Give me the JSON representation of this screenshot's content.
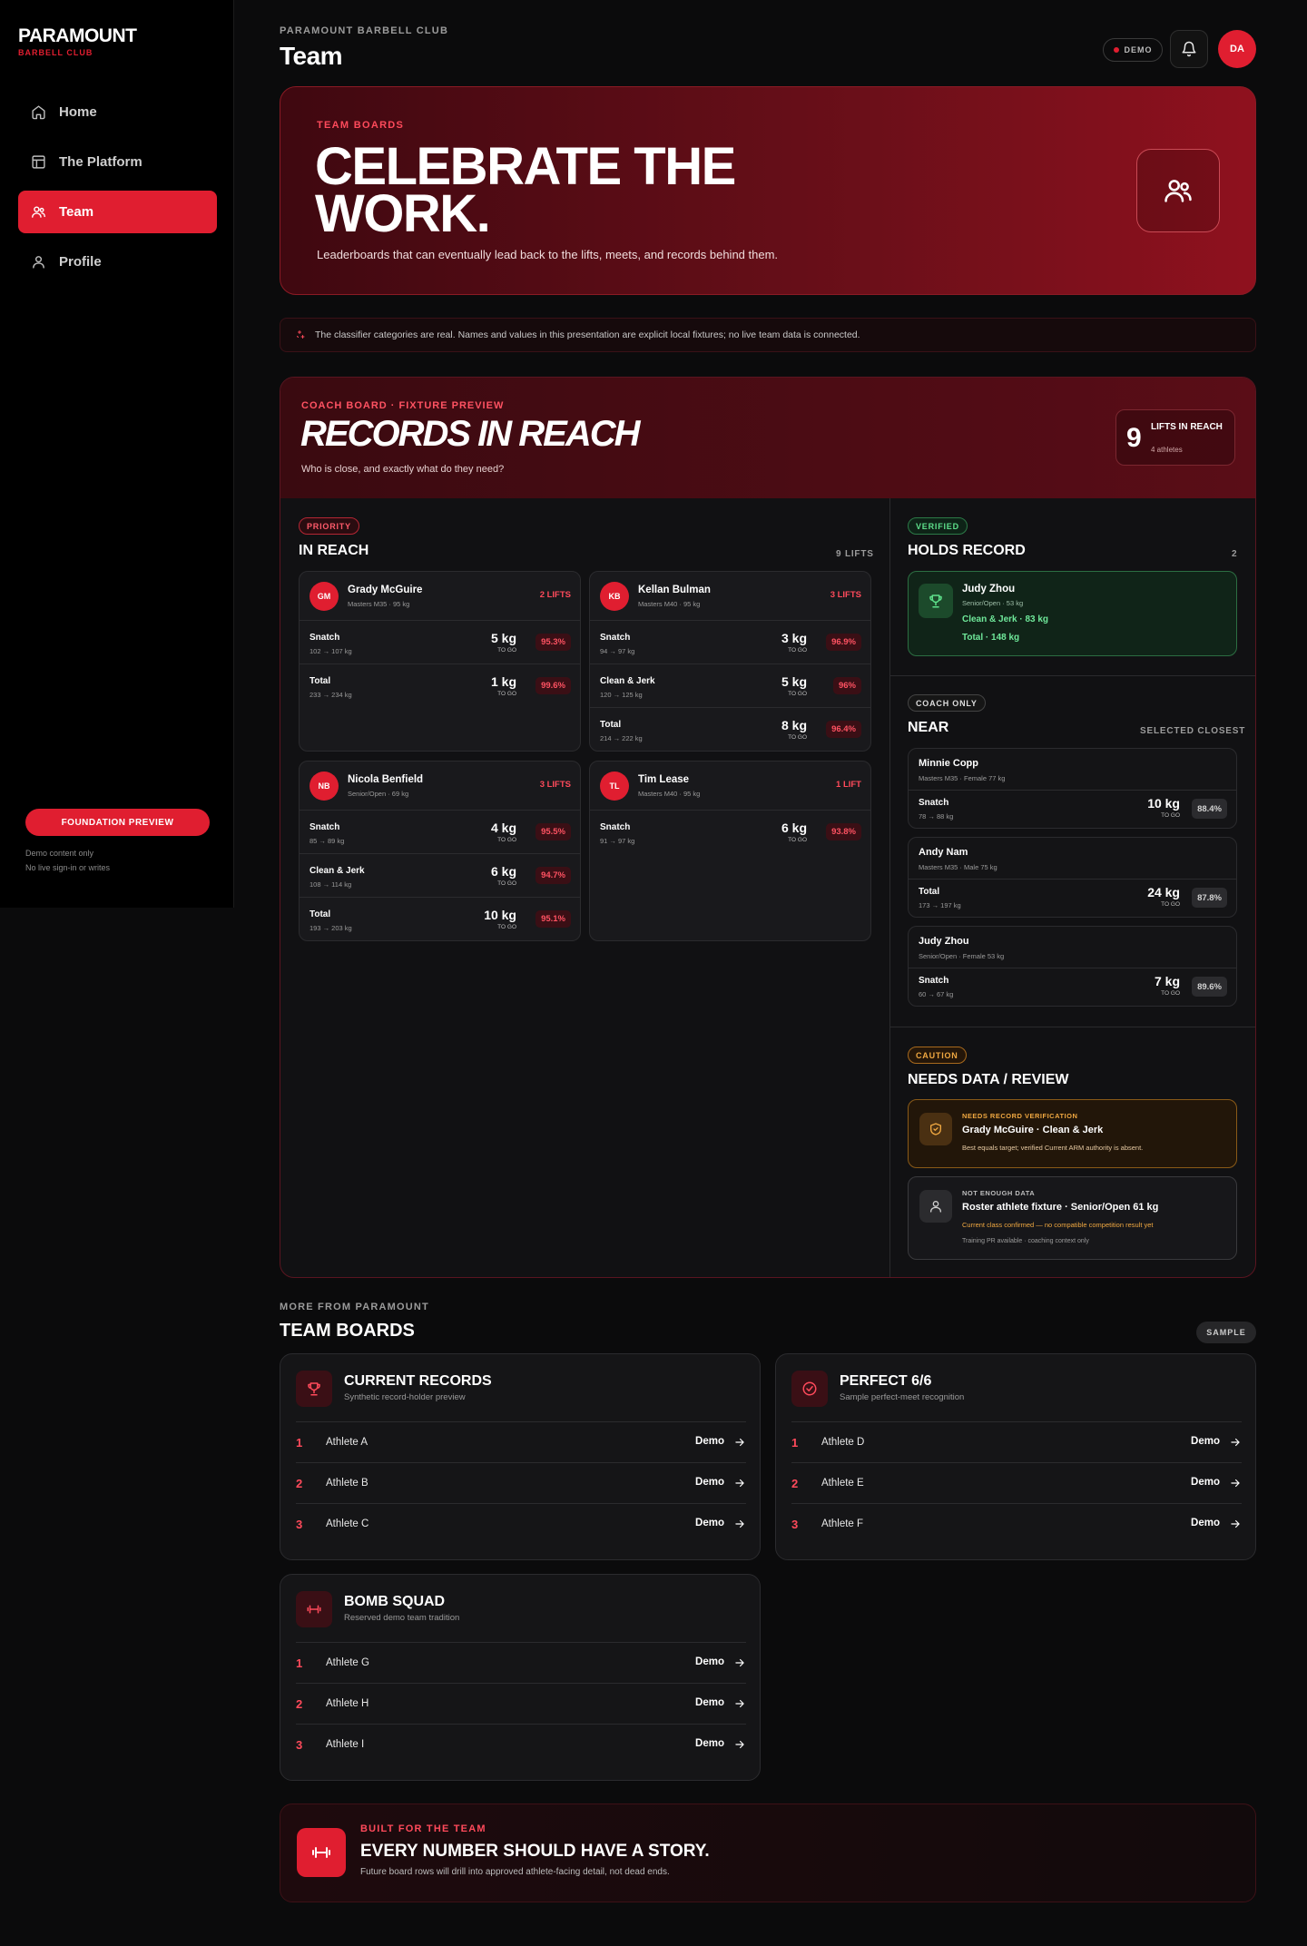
{
  "sidebar": {
    "brand_name": "PARAMOUNT",
    "brand_sub": "BARBELL CLUB",
    "items": [
      {
        "label": "Home",
        "icon": "home-icon"
      },
      {
        "label": "The Platform",
        "icon": "layout-icon"
      },
      {
        "label": "Team",
        "icon": "users-icon",
        "active": true
      },
      {
        "label": "Profile",
        "icon": "user-icon"
      }
    ],
    "preview_button": "FOUNDATION PREVIEW",
    "note_1": "Demo content only",
    "note_2": "No live sign-in or writes"
  },
  "header": {
    "kicker": "PARAMOUNT BARBELL CLUB",
    "title": "Team",
    "demo_label": "DEMO",
    "avatar_initials": "DA"
  },
  "hero": {
    "kicker": "TEAM BOARDS",
    "headline": "CELEBRATE THE WORK.",
    "description": "Leaderboards that can eventually lead back to the lifts, meets, and records behind them."
  },
  "notice": "The classifier categories are real. Names and values in this presentation are explicit local fixtures; no live team data is connected.",
  "board": {
    "kicker": "COACH BOARD · FIXTURE PREVIEW",
    "title": "RECORDS IN REACH",
    "subtitle": "Who is close, and exactly what do they need?",
    "lifts_count": "9",
    "lifts_label": "LIFTS IN REACH",
    "lifts_sub": "4 athletes",
    "in_reach": {
      "badge": "PRIORITY",
      "title": "IN REACH",
      "count": "9 LIFTS",
      "athletes": [
        {
          "initials": "GM",
          "name": "Grady McGuire",
          "meta": "Masters M35 · 95 kg",
          "count": "2 LIFTS",
          "lifts": [
            {
              "name": "Snatch",
              "range": "102 → 107 kg",
              "kg": "5 kg",
              "togo": "TO GO",
              "pct": "95.3%"
            },
            {
              "name": "Total",
              "range": "233 → 234 kg",
              "kg": "1 kg",
              "togo": "TO GO",
              "pct": "99.6%"
            }
          ]
        },
        {
          "initials": "KB",
          "name": "Kellan Bulman",
          "meta": "Masters M40 · 95 kg",
          "count": "3 LIFTS",
          "lifts": [
            {
              "name": "Snatch",
              "range": "94 → 97 kg",
              "kg": "3 kg",
              "togo": "TO GO",
              "pct": "96.9%"
            },
            {
              "name": "Clean & Jerk",
              "range": "120 → 125 kg",
              "kg": "5 kg",
              "togo": "TO GO",
              "pct": "96%"
            },
            {
              "name": "Total",
              "range": "214 → 222 kg",
              "kg": "8 kg",
              "togo": "TO GO",
              "pct": "96.4%"
            }
          ]
        },
        {
          "initials": "NB",
          "name": "Nicola Benfield",
          "meta": "Senior/Open · 69 kg",
          "count": "3 LIFTS",
          "lifts": [
            {
              "name": "Snatch",
              "range": "85 → 89 kg",
              "kg": "4 kg",
              "togo": "TO GO",
              "pct": "95.5%"
            },
            {
              "name": "Clean & Jerk",
              "range": "108 → 114 kg",
              "kg": "6 kg",
              "togo": "TO GO",
              "pct": "94.7%"
            },
            {
              "name": "Total",
              "range": "193 → 203 kg",
              "kg": "10 kg",
              "togo": "TO GO",
              "pct": "95.1%"
            }
          ]
        },
        {
          "initials": "TL",
          "name": "Tim Lease",
          "meta": "Masters M40 · 95 kg",
          "count": "1 LIFT",
          "lifts": [
            {
              "name": "Snatch",
              "range": "91 → 97 kg",
              "kg": "6 kg",
              "togo": "TO GO",
              "pct": "93.8%"
            }
          ]
        }
      ]
    },
    "holds": {
      "badge": "VERIFIED",
      "title": "HOLDS RECORD",
      "count": "2",
      "name": "Judy Zhou",
      "meta": "Senior/Open · 53 kg",
      "line1": "Clean & Jerk · 83 kg",
      "line2": "Total · 148 kg"
    },
    "near": {
      "badge": "COACH ONLY",
      "title": "NEAR",
      "right": "SELECTED CLOSEST",
      "items": [
        {
          "name": "Minnie Copp",
          "meta": "Masters M35 · Female 77 kg",
          "lift": "Snatch",
          "range": "78 → 88 kg",
          "kg": "10 kg",
          "togo": "TO GO",
          "pct": "88.4%"
        },
        {
          "name": "Andy Nam",
          "meta": "Masters M35 · Male 75 kg",
          "lift": "Total",
          "range": "173 → 197 kg",
          "kg": "24 kg",
          "togo": "TO GO",
          "pct": "87.8%"
        },
        {
          "name": "Judy Zhou",
          "meta": "Senior/Open · Female 53 kg",
          "lift": "Snatch",
          "range": "60 → 67 kg",
          "kg": "7 kg",
          "togo": "TO GO",
          "pct": "89.6%"
        }
      ]
    },
    "review": {
      "badge": "CAUTION",
      "title": "NEEDS DATA / REVIEW",
      "items": [
        {
          "kicker": "NEEDS RECORD VERIFICATION",
          "title": "Grady McGuire · Clean & Jerk",
          "desc": "Best equals target; verified Current ARM authority is absent."
        },
        {
          "kicker": "NOT ENOUGH DATA",
          "title": "Roster athlete fixture · Senior/Open 61 kg",
          "desc": "Current class confirmed — no compatible competition result yet",
          "desc2": "Training PR available · coaching context only"
        }
      ]
    }
  },
  "more": {
    "kicker": "MORE FROM PARAMOUNT",
    "title": "TEAM BOARDS",
    "sample": "SAMPLE",
    "boards": [
      {
        "title": "CURRENT RECORDS",
        "sub": "Synthetic record-holder preview",
        "icon": "trophy-icon",
        "rows": [
          {
            "rank": "1",
            "name": "Athlete A",
            "val": "Demo"
          },
          {
            "rank": "2",
            "name": "Athlete B",
            "val": "Demo"
          },
          {
            "rank": "3",
            "name": "Athlete C",
            "val": "Demo"
          }
        ]
      },
      {
        "title": "PERFECT 6/6",
        "sub": "Sample perfect-meet recognition",
        "icon": "check-circle-icon",
        "rows": [
          {
            "rank": "1",
            "name": "Athlete D",
            "val": "Demo"
          },
          {
            "rank": "2",
            "name": "Athlete E",
            "val": "Demo"
          },
          {
            "rank": "3",
            "name": "Athlete F",
            "val": "Demo"
          }
        ]
      },
      {
        "title": "BOMB SQUAD",
        "sub": "Reserved demo team tradition",
        "icon": "barbell-icon",
        "rows": [
          {
            "rank": "1",
            "name": "Athlete G",
            "val": "Demo"
          },
          {
            "rank": "2",
            "name": "Athlete H",
            "val": "Demo"
          },
          {
            "rank": "3",
            "name": "Athlete I",
            "val": "Demo"
          }
        ]
      }
    ]
  },
  "footer": {
    "kicker": "BUILT FOR THE TEAM",
    "title": "EVERY NUMBER SHOULD HAVE A STORY.",
    "desc": "Future board rows will drill into approved athlete-facing detail, not dead ends."
  },
  "colors": {
    "accent": "#e01e30",
    "background": "#0b0b0c",
    "verified": "#5ee08b",
    "caution": "#f0a841"
  }
}
